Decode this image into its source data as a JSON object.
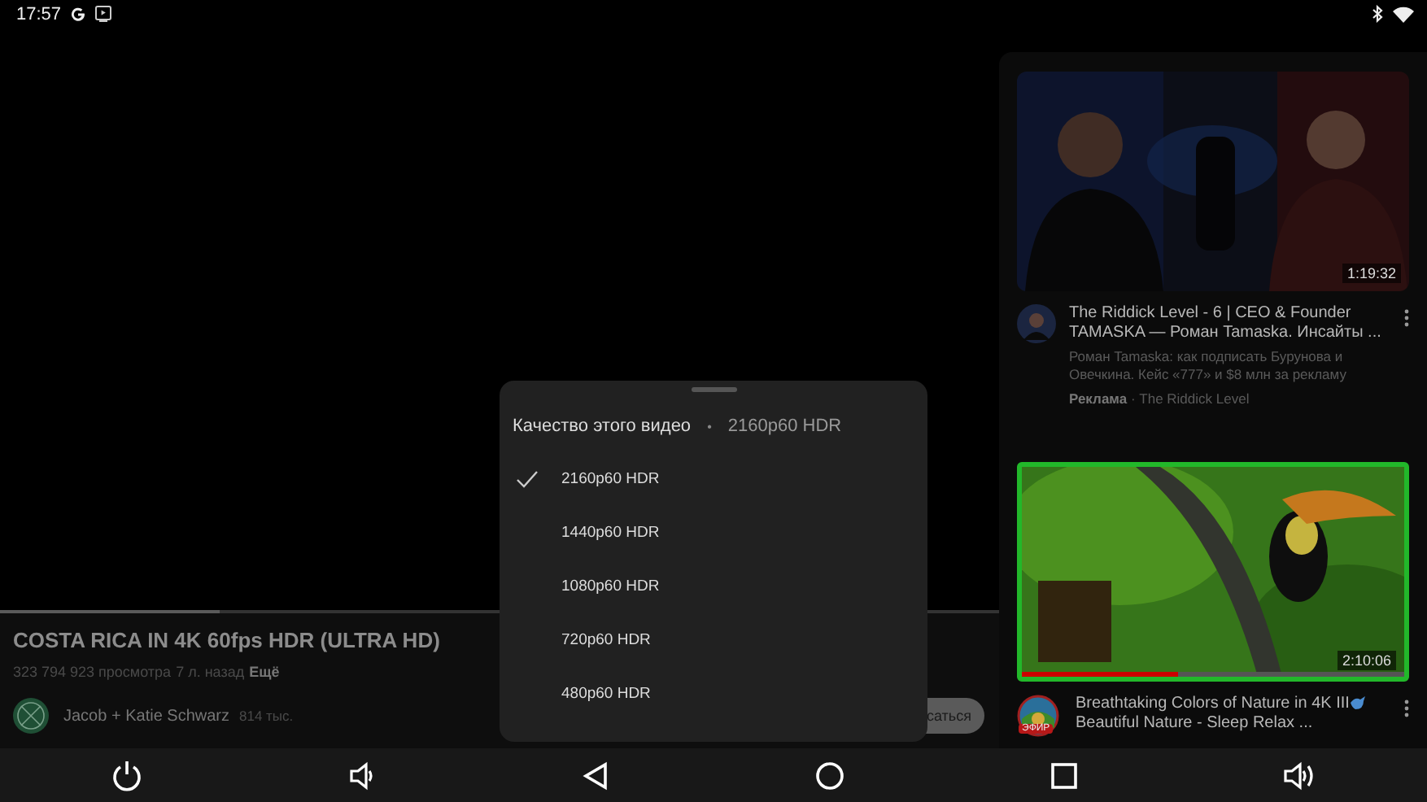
{
  "status_bar": {
    "time": "17:57"
  },
  "video": {
    "progress": {
      "level": 0.22
    },
    "title": "COSTA RICA IN 4K 60fps HDR (ULTRA HD)",
    "views": "323 794 923 просмотра",
    "age": "7 л. назад",
    "more": "Ещё",
    "channel": "Jacob + Katie Schwarz",
    "subscribers": "814 тыс.",
    "subscribe": "саться"
  },
  "quality_sheet": {
    "title": "Качество этого видео",
    "separator": "•",
    "current": "2160p60 HDR",
    "options": [
      {
        "label": "2160p60 HDR",
        "selected": true
      },
      {
        "label": "1440p60 HDR",
        "selected": false
      },
      {
        "label": "1080p60 HDR",
        "selected": false
      },
      {
        "label": "720p60 HDR",
        "selected": false
      },
      {
        "label": "480p60 HDR",
        "selected": false
      }
    ]
  },
  "related": [
    {
      "kind": "ad",
      "duration": "1:19:32",
      "title": "The Riddick Level - 6 | CEO & Founder TAMASKA — Роман Tamaska. Инсайты ...",
      "description": "Роман Tamaska: как подписать Бурунова и Овечкина. Кейс «777» и $8 млн за рекламу",
      "ad_label": "Реклама",
      "channel": "· The Riddick Level"
    },
    {
      "kind": "live",
      "duration": "2:10:06",
      "watched": {
        "level": 0.41
      },
      "title": "Breathtaking Colors of Nature in 4K III",
      "title_rest": "Beautiful Nature - Sleep Relax ...",
      "live_badge": "ЭФИР"
    }
  ]
}
